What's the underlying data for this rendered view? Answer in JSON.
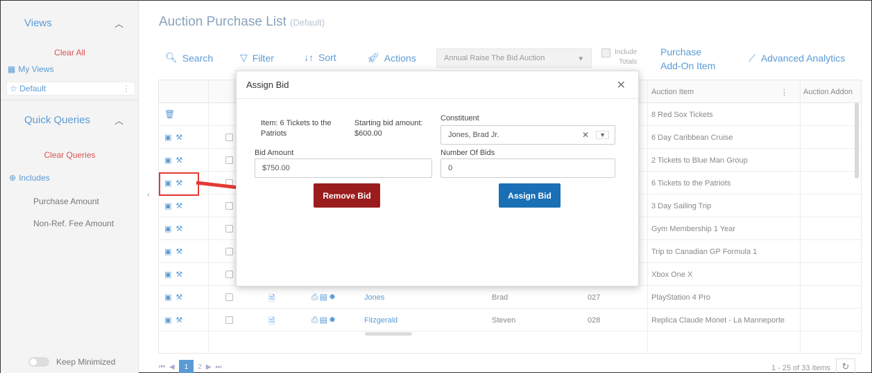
{
  "sidebar": {
    "views_title": "Views",
    "clear_all": "Clear All",
    "my_views": "My Views",
    "default_view": "Default",
    "quick_queries_title": "Quick Queries",
    "clear_queries": "Clear Queries",
    "includes": "Includes",
    "items": [
      "Purchase Amount",
      "Non-Ref. Fee Amount"
    ],
    "keep_minimized": "Keep Minimized"
  },
  "header": {
    "title": "Auction Purchase List",
    "subtitle": "(Default)"
  },
  "toolbar": {
    "search": "Search",
    "filter": "Filter",
    "sort": "Sort",
    "actions": "Actions",
    "auction_select": "Annual Raise The Bid Auction",
    "include_totals_line1": "Include",
    "include_totals_line2": "Totals",
    "purchase_addon_line1": "Purchase",
    "purchase_addon_line2": "Add-On Item",
    "advanced_analytics": "Advanced Analytics"
  },
  "grid": {
    "headers": {
      "auction_item": "Auction Item",
      "auction_addon": "Auction Addon"
    },
    "rows": [
      {
        "item": "8 Red Sox Tickets"
      },
      {
        "item": "6 Day Caribbean Cruise"
      },
      {
        "item": "2 Tickets to Blue Man Group"
      },
      {
        "item": "6 Tickets to the Patriots"
      },
      {
        "item": "3 Day Sailing Trip"
      },
      {
        "item": "Gym Membership 1 Year"
      },
      {
        "item": "Trip to Canadian GP Formula 1"
      },
      {
        "item": "Xbox One X"
      },
      {
        "last": "Jones",
        "first": "Brad",
        "num": "027",
        "item": "PlayStation 4 Pro"
      },
      {
        "last": "Fitzgerald",
        "first": "Steven",
        "num": "028",
        "item": "Replica Claude Monet - La Manneporte"
      }
    ],
    "pager": {
      "current": "1",
      "next": "2"
    },
    "items_count": "1 - 25 of 33 items"
  },
  "modal": {
    "title": "Assign Bid",
    "item_text": "Item: 6 Tickets to the Patriots",
    "starting_bid_label": "Starting bid amount:",
    "starting_bid_value": "$600.00",
    "constituent_label": "Constituent",
    "constituent_value": "Jones, Brad Jr.",
    "bid_amount_label": "Bid Amount",
    "bid_amount_value": "$750.00",
    "number_of_bids_label": "Number Of Bids",
    "number_of_bids_value": "0",
    "remove_bid": "Remove Bid",
    "assign_bid": "Assign Bid"
  },
  "colors": {
    "accent": "#5b9bd5",
    "danger": "#9b1c1c",
    "primary": "#1a6fb5",
    "highlight": "#e53935"
  }
}
